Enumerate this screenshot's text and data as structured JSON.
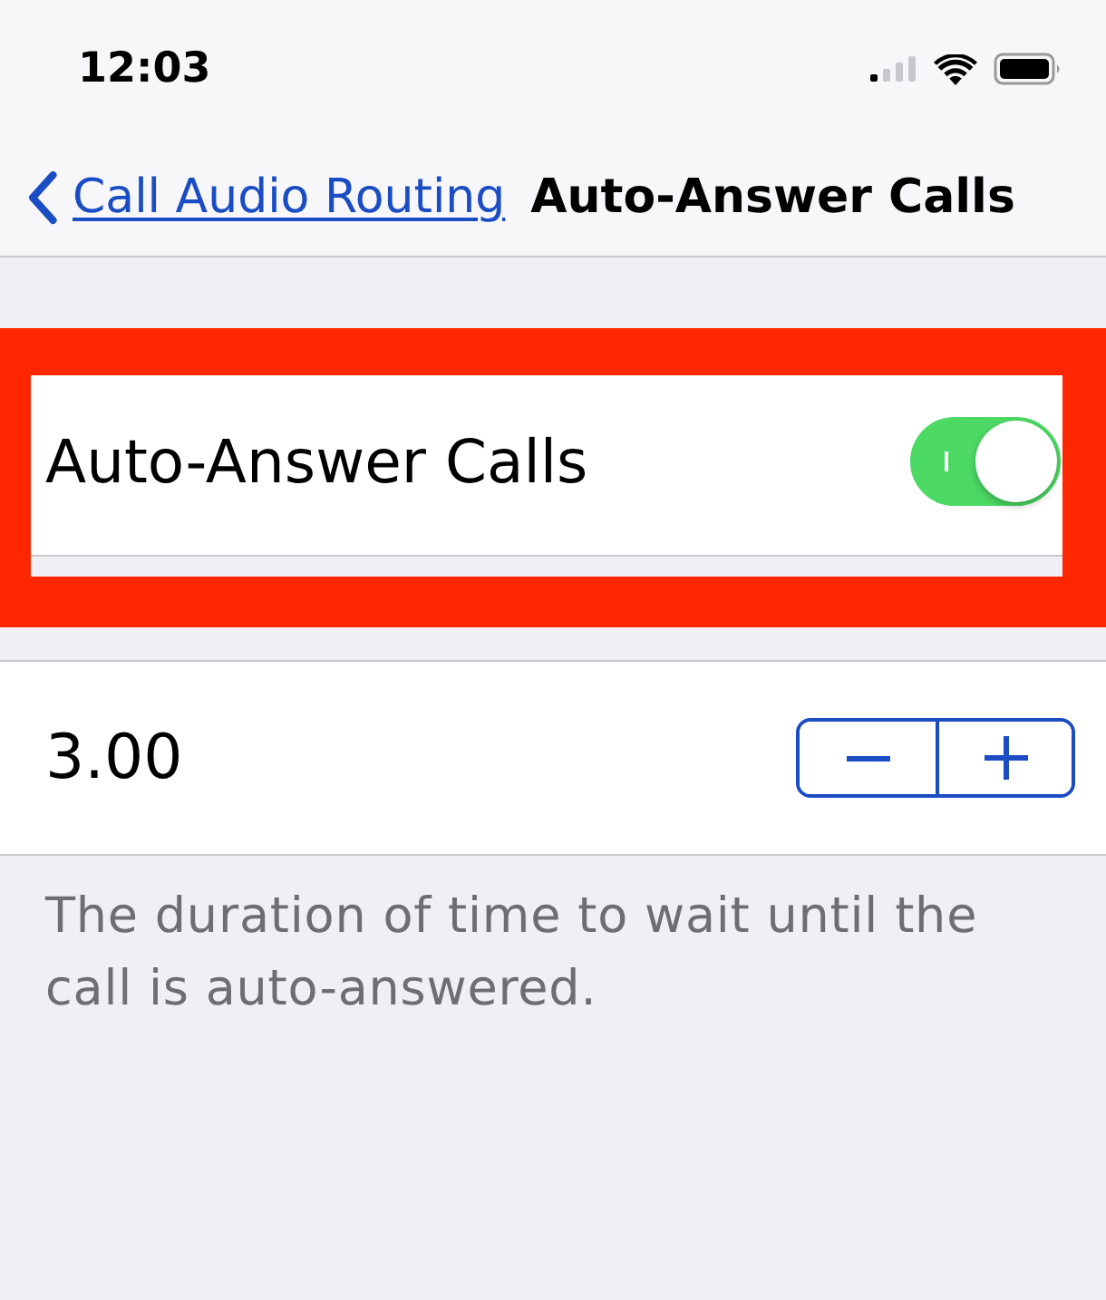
{
  "status_bar": {
    "time": "12:03"
  },
  "nav": {
    "back_label": "Call Audio Routing",
    "title": "Auto-Answer Calls"
  },
  "toggle_row": {
    "label": "Auto-Answer Calls",
    "on": true,
    "highlighted": true
  },
  "stepper_row": {
    "value": "3.00"
  },
  "footer": "The duration of time to wait until the call is auto-answered."
}
